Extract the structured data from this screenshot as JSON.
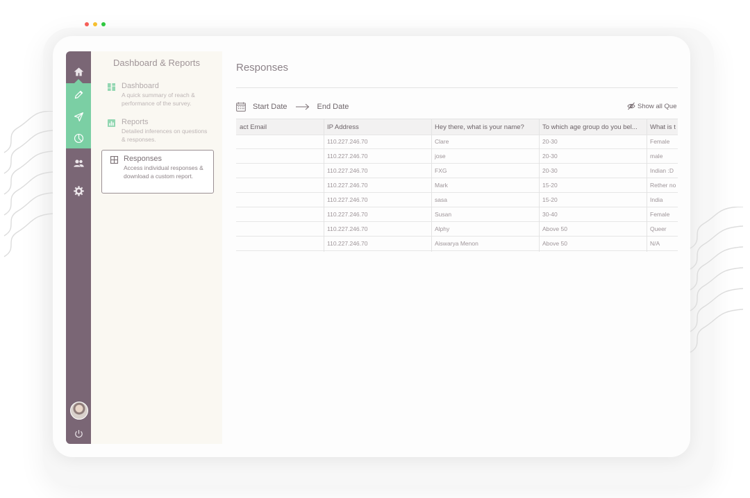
{
  "window": {
    "controls": [
      {
        "name": "close",
        "color": "#f65f58"
      },
      {
        "name": "minimize",
        "color": "#f6bf2f"
      },
      {
        "name": "maximize",
        "color": "#2fc840"
      }
    ]
  },
  "rail": {
    "items": [
      {
        "icon": "home-icon"
      },
      {
        "icon": "pencil-icon"
      },
      {
        "icon": "send-icon"
      },
      {
        "icon": "pie-chart-icon",
        "active": true
      },
      {
        "icon": "people-icon"
      },
      {
        "icon": "gear-icon"
      }
    ],
    "bottom": [
      {
        "icon": "avatar"
      },
      {
        "icon": "power-icon"
      }
    ],
    "colors": {
      "background": "#7a6675",
      "accent": "#7bcfa4"
    }
  },
  "subnav": {
    "title": "Dashboard & Reports",
    "items": [
      {
        "label": "Dashboard",
        "description": "A quick summary of reach & performance of the survey.",
        "icon": "dashboard-icon"
      },
      {
        "label": "Reports",
        "description": "Detailed inferences on questions & responses.",
        "icon": "bar-chart-icon"
      },
      {
        "label": "Responses",
        "description": "Access individual responses & download a custom report.",
        "icon": "grid-icon",
        "active": true
      }
    ]
  },
  "main": {
    "title": "Responses",
    "date_filter": {
      "start": "Start Date",
      "end": "End Date"
    },
    "show_all": "Show all Que",
    "table": {
      "columns": [
        "act Email",
        "IP Address",
        "Hey there, what is your name?",
        "To which age group do you bel...",
        "What is t"
      ],
      "rows": [
        [
          "",
          "110.227.246.70",
          "Clare",
          "20-30",
          "Female"
        ],
        [
          "",
          "110.227.246.70",
          "jose",
          "20-30",
          "male"
        ],
        [
          "",
          "110.227.246.70",
          "FXG",
          "20-30",
          "Indian :D"
        ],
        [
          "",
          "110.227.246.70",
          "Mark",
          "15-20",
          "Rether no"
        ],
        [
          "",
          "110.227.246.70",
          "sasa",
          "15-20",
          "India"
        ],
        [
          "",
          "110.227.246.70",
          "Susan",
          "30-40",
          "Female"
        ],
        [
          "",
          "110.227.246.70",
          "Alphy",
          "Above 50",
          "Queer"
        ],
        [
          "",
          "110.227.246.70",
          "Aiswarya Menon",
          "Above 50",
          "N/A"
        ]
      ]
    }
  }
}
